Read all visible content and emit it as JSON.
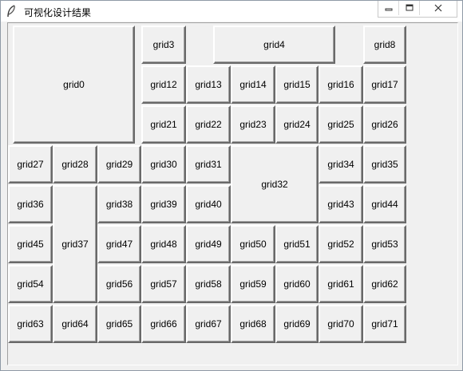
{
  "window": {
    "title": "可视化设计结果",
    "controls": [
      "minimize-icon",
      "maximize-icon",
      "close-icon"
    ]
  },
  "buttons": [
    "grid0",
    "grid3",
    "grid4",
    "grid8",
    "grid12",
    "grid13",
    "grid14",
    "grid15",
    "grid16",
    "grid17",
    "grid21",
    "grid22",
    "grid23",
    "grid24",
    "grid25",
    "grid26",
    "grid27",
    "grid28",
    "grid29",
    "grid30",
    "grid31",
    "grid32",
    "grid34",
    "grid35",
    "grid36",
    "grid37",
    "grid38",
    "grid39",
    "grid40",
    "grid43",
    "grid44",
    "grid45",
    "grid47",
    "grid48",
    "grid49",
    "grid50",
    "grid51",
    "grid52",
    "grid53",
    "grid54",
    "grid56",
    "grid57",
    "grid58",
    "grid59",
    "grid60",
    "grid61",
    "grid62",
    "grid63",
    "grid64",
    "grid65",
    "grid66",
    "grid67",
    "grid68",
    "grid69",
    "grid70",
    "grid71"
  ]
}
